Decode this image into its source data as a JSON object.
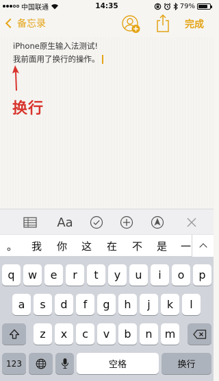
{
  "status": {
    "carrier": "中国联通",
    "time": "14:35",
    "battery": "79%",
    "battery_level": 0.79
  },
  "nav": {
    "back_label": "备忘录",
    "done_label": "完成"
  },
  "note": {
    "line1": "iPhone原生输入法测试!",
    "line2": "我前面用了换行的操作。"
  },
  "annotation": {
    "label": "换行",
    "color": "#d8342d"
  },
  "toolbar": {
    "format_label": "Aa"
  },
  "candidates": [
    "。",
    "我",
    "你",
    "这",
    "在",
    "不",
    "是",
    "一"
  ],
  "keyboard": {
    "row1": [
      "q",
      "w",
      "e",
      "r",
      "t",
      "y",
      "u",
      "i",
      "o",
      "p"
    ],
    "row2": [
      "a",
      "s",
      "d",
      "f",
      "g",
      "h",
      "j",
      "k",
      "l"
    ],
    "row3": [
      "z",
      "x",
      "c",
      "v",
      "b",
      "n",
      "m"
    ],
    "numbers_label": "123",
    "space_label": "空格",
    "return_label": "换行"
  },
  "colors": {
    "accent": "#e4a416",
    "keyboard_bg": "#d1d4da",
    "key_bg": "#ffffff",
    "key_dark_bg": "#adb3bc"
  }
}
